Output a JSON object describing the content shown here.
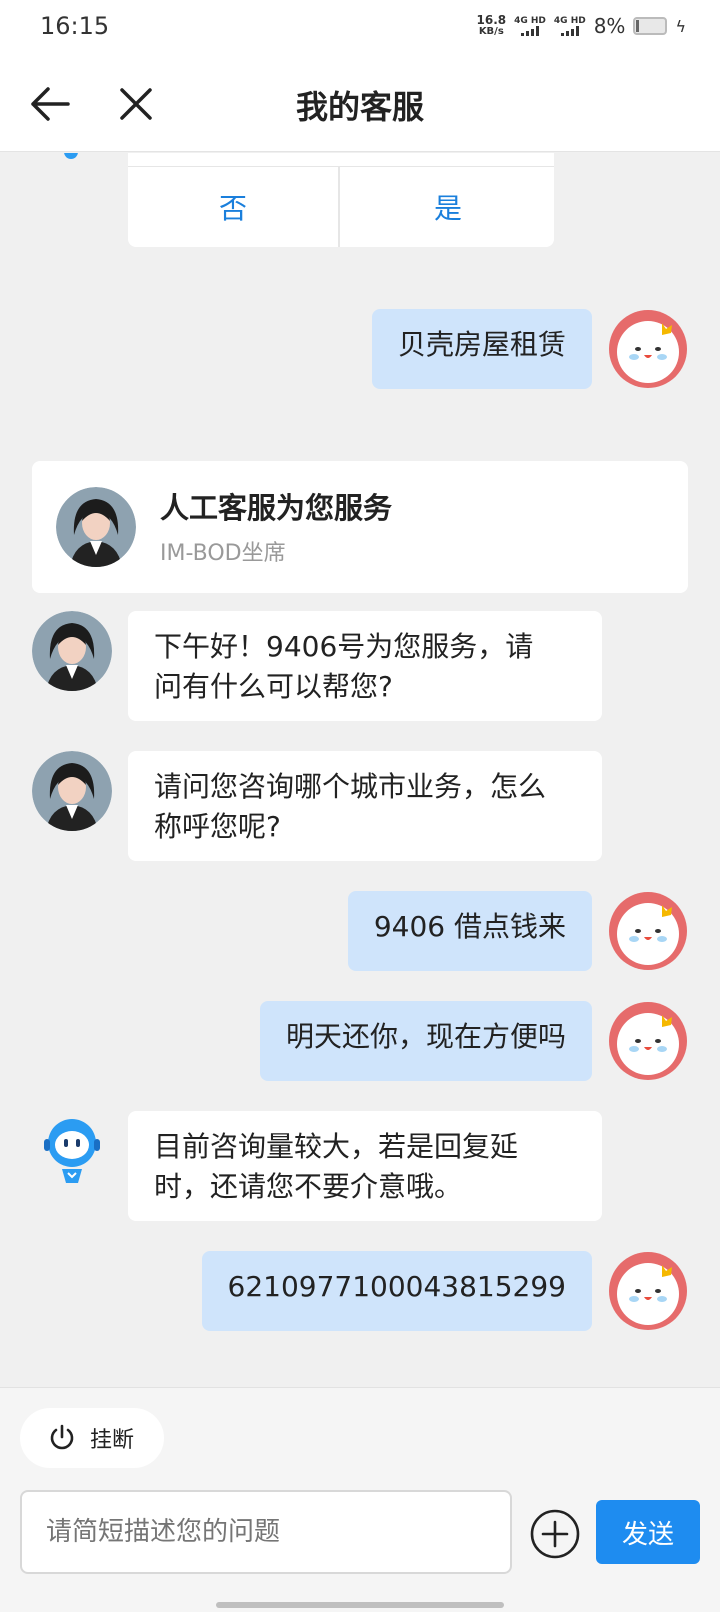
{
  "status_bar": {
    "time": "16:15",
    "net_speed_value": "16.8",
    "net_speed_unit": "KB/s",
    "sim1": "4G HD",
    "sim2": "4G HD",
    "battery": "8%"
  },
  "header": {
    "title": "我的客服"
  },
  "choice_card": {
    "no_label": "否",
    "yes_label": "是"
  },
  "messages": [
    {
      "from": "user",
      "text": "贝壳房屋租赁"
    },
    {
      "from": "agent",
      "text": "下午好！9406号为您服务，请\n问有什么可以帮您?"
    },
    {
      "from": "agent",
      "text": "请问您咨询哪个城市业务，怎么\n称呼您呢?"
    },
    {
      "from": "user",
      "text": "9406 借点钱来"
    },
    {
      "from": "user",
      "text": "明天还你，现在方便吗"
    },
    {
      "from": "bot",
      "text": "目前咨询量较大，若是回复延\n时，还请您不要介意哦。"
    },
    {
      "from": "user",
      "text": "6210977100043815299"
    }
  ],
  "agent_card": {
    "title": "人工客服为您服务",
    "subtitle": "IM-BOD坐席"
  },
  "bottom": {
    "hangup_label": "挂断",
    "input_placeholder": "请简短描述您的问题",
    "send_label": "发送"
  },
  "colors": {
    "accent": "#1e8cf0",
    "user_bubble": "#cfe4fb",
    "choice_text": "#1a7fdc"
  }
}
